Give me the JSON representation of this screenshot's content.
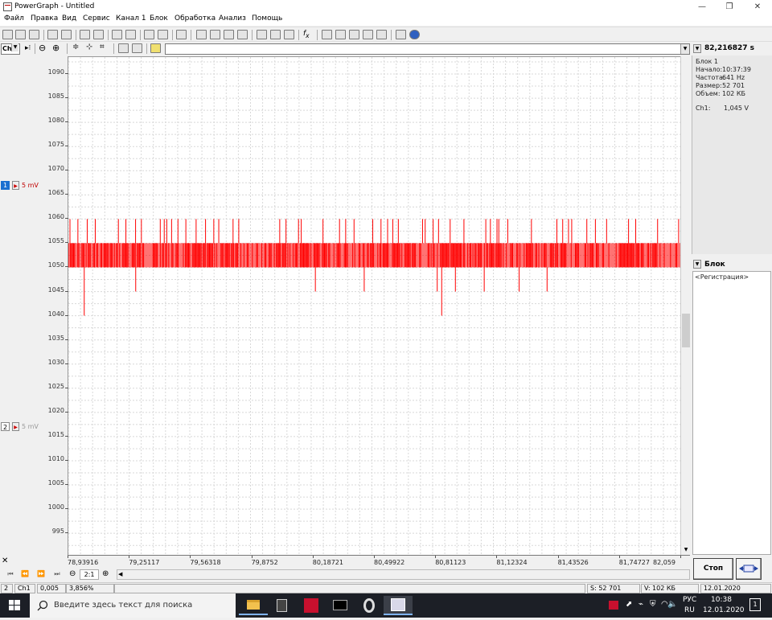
{
  "window": {
    "title": "PowerGraph - Untitled",
    "minimize": "—",
    "maximize": "❐",
    "close": "✕"
  },
  "menu": [
    "Файл",
    "Правка",
    "Вид",
    "Сервис",
    "Канал 1",
    "Блок",
    "Обработка",
    "Анализ",
    "Помощь"
  ],
  "toolbar2": {
    "channel_select": "Ch"
  },
  "time_readout": "82,216827 s",
  "info": {
    "block_label": "Блок 1",
    "start_label": "Начало:",
    "start_value": "10:37:39",
    "freq_label": "Частота:",
    "freq_value": "641 Hz",
    "size_label": "Размер:",
    "size_value": "52 701",
    "volume_label": "Объем:",
    "volume_value": "102 КБ",
    "ch1_label": "Ch1:",
    "ch1_value": "1,045 V"
  },
  "blocks": {
    "title": "Блок",
    "item": "<Регистрация>"
  },
  "channels": [
    {
      "num": "1",
      "scale": "5 mV",
      "color": "#c00000",
      "active": true
    },
    {
      "num": "2",
      "scale": "5 mV",
      "color": "#999999",
      "active": false
    }
  ],
  "chart_data": {
    "type": "line",
    "title": "",
    "xlabel": "",
    "ylabel": "",
    "ylim": [
      992,
      1093
    ],
    "xlim": [
      78.93916,
      82.059
    ],
    "y_ticks": [
      1090,
      1085,
      1080,
      1075,
      1070,
      1065,
      1060,
      1055,
      1050,
      1045,
      1040,
      1035,
      1030,
      1025,
      1020,
      1015,
      1010,
      1005,
      1000,
      995
    ],
    "x_ticks": [
      "78,93916",
      "79,25117",
      "79,56318",
      "79,8752",
      "80,18721",
      "80,49922",
      "80,81123",
      "81,12324",
      "81,43526",
      "81,74727",
      "82,059"
    ],
    "grid": true,
    "series": [
      {
        "name": "Ch1",
        "color": "#ff0000",
        "band_low": 1050,
        "band_high": 1055,
        "spikes_up_to": 1060,
        "spikes_down_to": 1045,
        "min_spikes": [
          {
            "x": 79.02,
            "y": 1040
          },
          {
            "x": 80.84,
            "y": 1040
          }
        ]
      }
    ]
  },
  "bottom": {
    "zoom": "2:1",
    "stop_button": "Стоп",
    "status": {
      "num": "2",
      "channel": "Ch1",
      "value": "0,005 ±",
      "percent": "3,856%",
      "samples": "S: 52 701",
      "volume": "V: 102 КБ",
      "date": "12.01.2020"
    }
  },
  "taskbar": {
    "search_placeholder": "Введите здесь текст для поиска",
    "lang_top": "РУС",
    "lang_bottom": "RU",
    "time": "10:38",
    "date": "12.01.2020",
    "notifications": "1"
  }
}
